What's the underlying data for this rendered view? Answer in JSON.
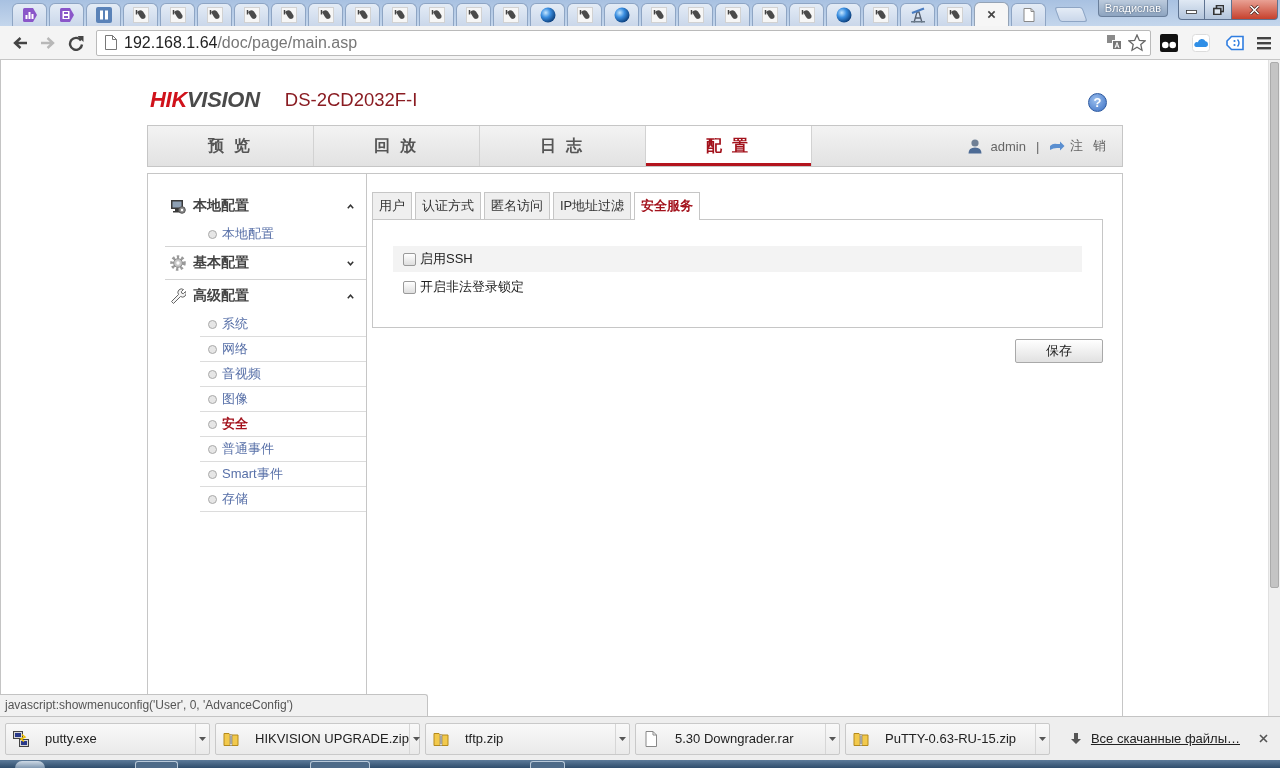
{
  "browser": {
    "tabs": [
      {
        "kind": "chart",
        "selected": false
      },
      {
        "kind": "document",
        "selected": false
      },
      {
        "kind": "pause",
        "selected": false
      },
      {
        "kind": "camera",
        "selected": false
      },
      {
        "kind": "camera",
        "selected": false
      },
      {
        "kind": "camera",
        "selected": false
      },
      {
        "kind": "camera",
        "selected": false
      },
      {
        "kind": "camera",
        "selected": false
      },
      {
        "kind": "camera",
        "selected": false
      },
      {
        "kind": "camera",
        "selected": false
      },
      {
        "kind": "camera",
        "selected": false
      },
      {
        "kind": "camera",
        "selected": false
      },
      {
        "kind": "camera",
        "selected": false
      },
      {
        "kind": "camera",
        "selected": false
      },
      {
        "kind": "sphere",
        "selected": false
      },
      {
        "kind": "camera",
        "selected": false
      },
      {
        "kind": "sphere",
        "selected": false
      },
      {
        "kind": "camera",
        "selected": false
      },
      {
        "kind": "camera",
        "selected": false
      },
      {
        "kind": "camera",
        "selected": false
      },
      {
        "kind": "camera",
        "selected": false
      },
      {
        "kind": "camera",
        "selected": false
      },
      {
        "kind": "sphere",
        "selected": false
      },
      {
        "kind": "camera",
        "selected": false
      },
      {
        "kind": "antenna",
        "selected": false
      },
      {
        "kind": "camera",
        "selected": false
      },
      {
        "selected": true
      },
      {
        "kind": "page",
        "selected": false
      }
    ],
    "profile": "Владислав",
    "nav_buttons": [
      {
        "kind": "back",
        "disabled": false
      },
      {
        "kind": "forward",
        "disabled": true
      },
      {
        "kind": "reload",
        "disabled": false
      }
    ],
    "address": {
      "host": "192.168.1.64",
      "path": "/doc/page/main.asp"
    },
    "extensions": [
      {
        "kind": "glasses"
      },
      {
        "kind": "cloud"
      },
      {
        "kind": "tag"
      }
    ]
  },
  "header": {
    "logo": {
      "primary": "HIK",
      "secondary": "VISION"
    },
    "model": "DS-2CD2032F-I",
    "help": "?"
  },
  "nav": {
    "tabs": [
      {
        "label": "预 览",
        "selected": false
      },
      {
        "label": "回 放",
        "selected": false
      },
      {
        "label": "日 志",
        "selected": false
      },
      {
        "label": "配 置",
        "selected": true
      }
    ],
    "user": "admin",
    "separator": "|",
    "logout": "注 销"
  },
  "sidebar": {
    "groups": [
      {
        "kind": "monitor",
        "label": "本地配置",
        "expanded": true,
        "items": [
          {
            "label": "本地配置",
            "selected": false
          }
        ]
      },
      {
        "kind": "gear",
        "label": "基本配置",
        "expanded": false
      },
      {
        "kind": "wrench",
        "label": "高级配置",
        "expanded": true,
        "items": [
          {
            "label": "系统",
            "selected": false
          },
          {
            "label": "网络",
            "selected": false
          },
          {
            "label": "音视频",
            "selected": false
          },
          {
            "label": "图像",
            "selected": false
          },
          {
            "label": "安全",
            "selected": true
          },
          {
            "label": "普通事件",
            "selected": false
          },
          {
            "label": "Smart事件",
            "selected": false
          },
          {
            "label": "存储",
            "selected": false
          }
        ]
      }
    ]
  },
  "content": {
    "tabs": [
      {
        "label": "用户",
        "selected": false
      },
      {
        "label": "认证方式",
        "selected": false
      },
      {
        "label": "匿名访问",
        "selected": false
      },
      {
        "label": "IP地址过滤",
        "selected": false
      },
      {
        "label": "安全服务",
        "selected": true
      }
    ],
    "options": [
      {
        "label": "启用SSH",
        "checked": false,
        "highlighted": true
      },
      {
        "label": "开启非法登录锁定",
        "checked": false,
        "highlighted": false
      }
    ],
    "save_button": "保存"
  },
  "status_bubble": "javascript:showmenuconfig('User', 0, 'AdvanceConfig')",
  "downloads": {
    "items": [
      {
        "kind": "exe",
        "name": "putty.exe"
      },
      {
        "kind": "zip",
        "name": "HIKVISION UPGRADE.zip"
      },
      {
        "kind": "zip",
        "name": "tftp.zip"
      },
      {
        "kind": "file",
        "name": "5.30 Downgrader.rar"
      },
      {
        "kind": "zip",
        "name": "PuTTY-0.63-RU-15.zip"
      }
    ],
    "show_all": "Все скачанные файлы…"
  }
}
